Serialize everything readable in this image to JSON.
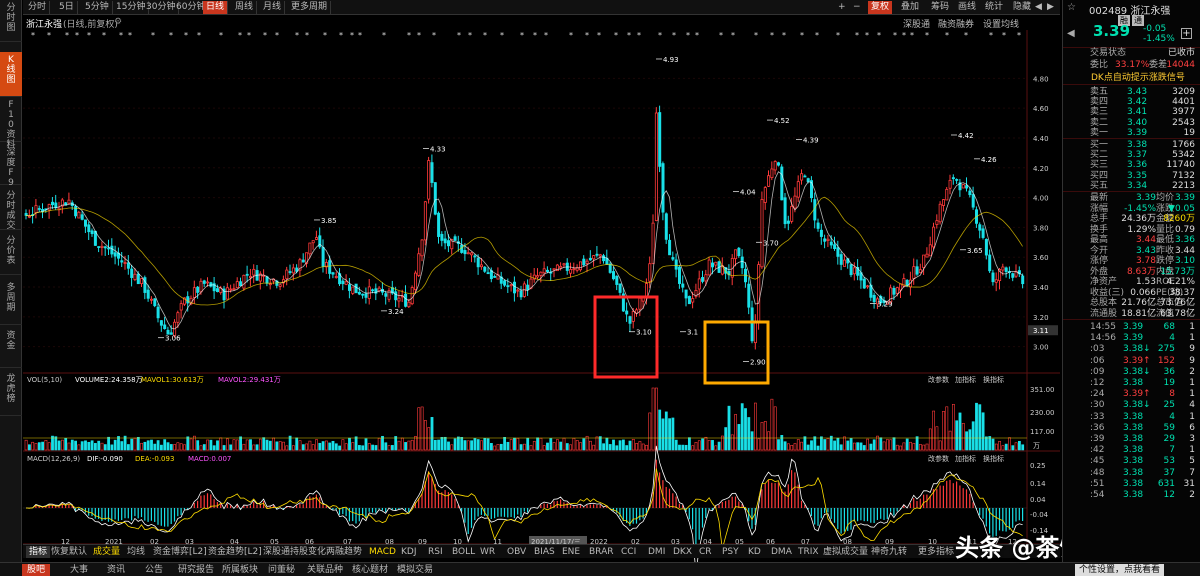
{
  "left_nav": [
    "分时图",
    "K线图",
    "F10资料",
    "深度F9",
    "分时成交",
    "分价表",
    "多周期",
    "资金",
    "龙虎榜"
  ],
  "top_tabs": [
    "分时",
    "5日",
    "5分钟",
    "15分钟",
    "30分钟",
    "60分钟",
    "日线",
    "周线",
    "月线",
    "更多周期"
  ],
  "active_top_tab": "日线",
  "top_right": {
    "plus": "+",
    "minus": "−",
    "restore": "复权",
    "overlay": "叠加",
    "chips": "筹码",
    "drawline": "画线",
    "stats": "统计",
    "hide": "隐藏",
    "nav_left": "◀",
    "nav_right": "▶"
  },
  "title_bar": {
    "stock": "浙江永强",
    "mode": "(日线,前复权)",
    "gear_icon": "gear-icon",
    "right_items": [
      "深股通",
      "融资融券",
      "设置均线"
    ]
  },
  "axis_main": [
    "4.80",
    "4.60",
    "4.40",
    "4.20",
    "4.00",
    "3.80",
    "3.60",
    "3.40",
    "3.20",
    "3.00"
  ],
  "axis_current": "3.11",
  "price_annotations": [
    "4.93",
    "4.33",
    "4.52",
    "4.39",
    "4.42",
    "4.26",
    "4.04",
    "3.85",
    "3.70",
    "3.65",
    "3.29",
    "3.24",
    "3.10",
    "3.1",
    "3.06",
    "2.90"
  ],
  "vol_panel": {
    "label": "VOL(5,10)",
    "volume": "VOLUME2:24.358万",
    "ma1": "MAVOL1:30.613万",
    "ma2": "MAVOL2:29.431万",
    "axis": [
      "351.00",
      "230.00",
      "117.00",
      "万"
    ],
    "tools": [
      "改参数",
      "加指标",
      "换指标"
    ]
  },
  "macd_panel": {
    "label": "MACD(12,26,9)",
    "dif": "DIF:-0.090",
    "dea": "DEA:-0.093",
    "macd": "MACD:0.007",
    "axis": [
      "0.25",
      "0.14",
      "0.04",
      "-0.04",
      "-0.14"
    ],
    "tools": [
      "改参数",
      "加指标",
      "换指标"
    ]
  },
  "date_axis": [
    "12",
    "2021",
    "02",
    "03",
    "04",
    "05",
    "06",
    "07",
    "08",
    "09",
    "10",
    "11",
    "2021/11/17/三",
    "2022",
    "02",
    "03",
    "04",
    "05",
    "06",
    "07",
    "08",
    "09",
    "10",
    "11",
    "12"
  ],
  "bottom_tabs": [
    "指标",
    "恢复默认",
    "成交量",
    "均线",
    "资金博弈[L2]",
    "资金趋势[L2]",
    "深股通持股变化",
    "两融趋势",
    "MACD",
    "KDJ",
    "RSI",
    "BOLL",
    "WR",
    "OBV",
    "BIAS",
    "ENE",
    "BRAR",
    "CCI",
    "DMI",
    "DKX",
    "CR",
    "PSY",
    "KD",
    "DMA",
    "TRIX",
    "虚拟成交量",
    "神奇九转",
    "更多指标"
  ],
  "status_bar": [
    "股吧",
    "大事",
    "资讯",
    "公告",
    "研究报告",
    "所属板块",
    "问董秘",
    "关联品种",
    "核心题材",
    "模拟交易"
  ],
  "status_right": "个性设置，点我看看",
  "watermark": "头条 @茶馆财经",
  "quote": {
    "code": "002489",
    "name": "浙江永强",
    "tags": [
      "融",
      "通"
    ],
    "price": "3.39",
    "change": "-0.05",
    "change_pct": "-1.45%",
    "trade_status_label": "交易状态",
    "trade_status": "已收市",
    "ratio_label": "委比",
    "ratio": "33.17%",
    "diff_label": "委差",
    "diff": "14044",
    "signal_link": "DK点自动提示涨跌信号",
    "sells": [
      [
        "卖五",
        "3.43",
        "3209"
      ],
      [
        "卖四",
        "3.42",
        "4401"
      ],
      [
        "卖三",
        "3.41",
        "3977"
      ],
      [
        "卖二",
        "3.40",
        "2543"
      ],
      [
        "卖一",
        "3.39",
        "19"
      ]
    ],
    "buys": [
      [
        "买一",
        "3.38",
        "1766"
      ],
      [
        "买二",
        "3.37",
        "5342"
      ],
      [
        "买三",
        "3.36",
        "11740"
      ],
      [
        "买四",
        "3.35",
        "7132"
      ],
      [
        "买五",
        "3.34",
        "2213"
      ]
    ],
    "stats": [
      [
        "最新",
        "3.39",
        "均价",
        "3.39"
      ],
      [
        "涨幅",
        "-1.45%",
        "涨跌",
        "▼0.05"
      ],
      [
        "总手",
        "24.36万",
        "金额",
        "8260万"
      ],
      [
        "换手",
        "1.29%",
        "量比",
        "0.79"
      ],
      [
        "最高",
        "3.44",
        "最低",
        "3.36"
      ],
      [
        "今开",
        "3.43",
        "昨收",
        "3.44"
      ],
      [
        "涨停",
        "3.78",
        "跌停",
        "3.10"
      ],
      [
        "外盘",
        "8.63万",
        "内盘",
        "15.73万"
      ],
      [
        "净资产",
        "1.53",
        "ROE",
        "4.21%"
      ],
      [
        "收益(三)",
        "0.066",
        "PE(动)",
        "38.37"
      ],
      [
        "总股本",
        "21.76亿",
        "总市值",
        "73.76亿"
      ],
      [
        "流通股",
        "18.81亿",
        "流值",
        "63.78亿"
      ]
    ],
    "ticks": [
      [
        "14:55",
        "3.39",
        "68",
        "1"
      ],
      [
        "14:56",
        "3.39",
        "4",
        "1"
      ],
      [
        ":03",
        "3.38↓",
        "275",
        "9"
      ],
      [
        ":06",
        "3.39↑",
        "152",
        "9"
      ],
      [
        ":09",
        "3.38↓",
        "36",
        "2"
      ],
      [
        ":12",
        "3.38",
        "19",
        "1"
      ],
      [
        ":24",
        "3.39↑",
        "8",
        "1"
      ],
      [
        ":30",
        "3.38↓",
        "25",
        "4"
      ],
      [
        ":33",
        "3.38",
        "4",
        "1"
      ],
      [
        ":36",
        "3.38",
        "59",
        "6"
      ],
      [
        ":39",
        "3.38",
        "29",
        "3"
      ],
      [
        ":42",
        "3.38",
        "7",
        "1"
      ],
      [
        ":45",
        "3.38",
        "53",
        "5"
      ],
      [
        ":48",
        "3.38",
        "37",
        "7"
      ],
      [
        ":51",
        "3.38",
        "631",
        "31"
      ],
      [
        ":54",
        "3.38",
        "12",
        "2"
      ]
    ]
  },
  "colors": {
    "up": "#ff4040",
    "down": "#00e0e0",
    "accent": "#c8361e",
    "highlight_red": "#ff2a2a",
    "highlight_orange": "#ffaa00"
  }
}
